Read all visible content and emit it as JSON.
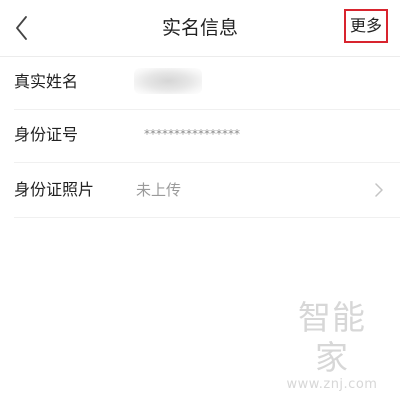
{
  "header": {
    "back_icon": "chevron-left-icon",
    "title": "实名信息",
    "more_label": "更多",
    "highlight_color": "#d8242e"
  },
  "rows": [
    {
      "label": "真实姓名",
      "value": ""
    },
    {
      "label": "身份证号",
      "value": "****************"
    },
    {
      "label": "身份证照片",
      "value": "未上传",
      "chevron_icon": "chevron-right-icon"
    }
  ],
  "watermark": {
    "logo_text": "智能家",
    "url": "www.znj.com"
  }
}
